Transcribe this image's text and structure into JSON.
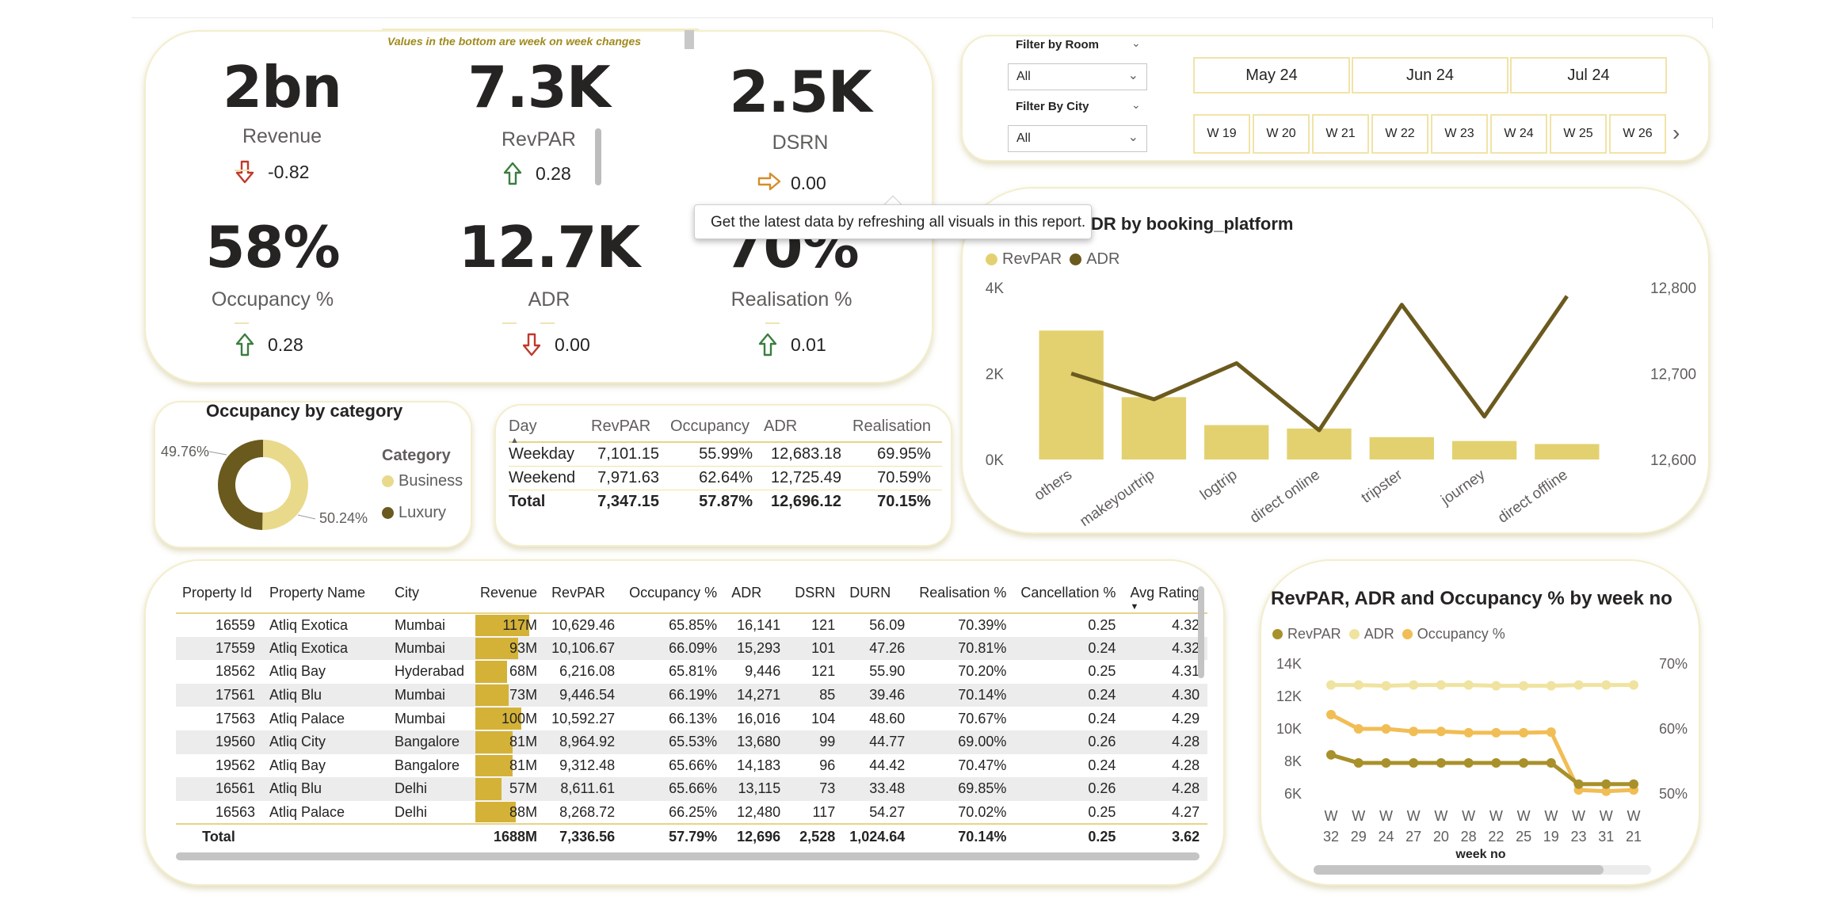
{
  "top_note": "Values in the bottom are week on week changes",
  "kpis": [
    {
      "value": "2bn",
      "label": "Revenue",
      "change": "-0.82",
      "direction": "down"
    },
    {
      "value": "7.3K",
      "label": "RevPAR",
      "change": "0.28",
      "direction": "up"
    },
    {
      "value": "2.5K",
      "label": "DSRN",
      "change": "0.00",
      "direction": "right"
    },
    {
      "value": "58%",
      "label": "Occupancy %",
      "change": "0.28",
      "direction": "up"
    },
    {
      "value": "12.7K",
      "label": "ADR",
      "change": "0.00",
      "direction": "down"
    },
    {
      "value": "70%",
      "label": "Realisation %",
      "change": "0.01",
      "direction": "up"
    }
  ],
  "tooltip": "Get the latest data by refreshing all visuals in this report.",
  "filters": {
    "room_title": "Filter by Room",
    "room_value": "All",
    "city_title": "Filter By City",
    "city_value": "All"
  },
  "months": [
    "May 24",
    "Jun 24",
    "Jul 24"
  ],
  "weeks": [
    "W 19",
    "W 20",
    "W 21",
    "W 22",
    "W 23",
    "W 24",
    "W 25",
    "W 26"
  ],
  "combo_chart": {
    "title": "DR by booking_platform",
    "legend": [
      "RevPAR",
      "ADR"
    ],
    "colors": {
      "revpar": "#e3d170",
      "adr": "#6b5a1e"
    }
  },
  "donut": {
    "title": "Occupancy by category",
    "legend_title": "Category",
    "colors": {
      "business": "#e9d98b",
      "luxury": "#6b5a1e"
    }
  },
  "day_table": {
    "headers": [
      "Day",
      "RevPAR",
      "Occupancy",
      "ADR",
      "Realisation"
    ],
    "rows": [
      [
        "Weekday",
        "7,101.15",
        "55.99%",
        "12,683.18",
        "69.95%"
      ],
      [
        "Weekend",
        "7,971.63",
        "62.64%",
        "12,725.49",
        "70.59%"
      ]
    ],
    "total": [
      "Total",
      "7,347.15",
      "57.87%",
      "12,696.12",
      "70.15%"
    ]
  },
  "property_table": {
    "headers": [
      "Property Id",
      "Property Name",
      "City",
      "Revenue",
      "RevPAR",
      "Occupancy %",
      "ADR",
      "DSRN",
      "DURN",
      "Realisation %",
      "Cancellation %",
      "Avg Rating"
    ],
    "rows": [
      [
        "16559",
        "Atliq Exotica",
        "Mumbai",
        "117M",
        "10,629.46",
        "65.85%",
        "16,141",
        "121",
        "56.09",
        "70.39%",
        "0.25",
        "4.32"
      ],
      [
        "17559",
        "Atliq Exotica",
        "Mumbai",
        "93M",
        "10,106.67",
        "66.09%",
        "15,293",
        "101",
        "47.26",
        "70.81%",
        "0.24",
        "4.32"
      ],
      [
        "18562",
        "Atliq Bay",
        "Hyderabad",
        "68M",
        "6,216.08",
        "65.81%",
        "9,446",
        "121",
        "55.90",
        "70.20%",
        "0.25",
        "4.31"
      ],
      [
        "17561",
        "Atliq Blu",
        "Mumbai",
        "73M",
        "9,446.54",
        "66.19%",
        "14,271",
        "85",
        "39.46",
        "70.14%",
        "0.24",
        "4.30"
      ],
      [
        "17563",
        "Atliq Palace",
        "Mumbai",
        "100M",
        "10,592.27",
        "66.13%",
        "16,016",
        "104",
        "48.60",
        "70.67%",
        "0.24",
        "4.29"
      ],
      [
        "19560",
        "Atliq City",
        "Bangalore",
        "81M",
        "8,964.92",
        "65.53%",
        "13,680",
        "99",
        "44.77",
        "69.00%",
        "0.26",
        "4.28"
      ],
      [
        "19562",
        "Atliq Bay",
        "Bangalore",
        "81M",
        "9,312.48",
        "65.66%",
        "14,183",
        "96",
        "44.42",
        "70.47%",
        "0.24",
        "4.28"
      ],
      [
        "16561",
        "Atliq Blu",
        "Delhi",
        "57M",
        "8,611.61",
        "65.66%",
        "13,115",
        "73",
        "33.48",
        "69.85%",
        "0.26",
        "4.28"
      ],
      [
        "16563",
        "Atliq Palace",
        "Delhi",
        "88M",
        "8,268.72",
        "66.25%",
        "12,480",
        "117",
        "54.27",
        "70.02%",
        "0.25",
        "4.27"
      ]
    ],
    "revenue_fraction": [
      1.0,
      0.795,
      0.581,
      0.624,
      0.855,
      0.692,
      0.692,
      0.487,
      0.752
    ],
    "total": [
      "Total",
      "",
      "",
      "1688M",
      "7,336.56",
      "57.79%",
      "12,696",
      "2,528",
      "1,024.64",
      "70.14%",
      "0.25",
      "3.62"
    ]
  },
  "week_chart": {
    "title": "RevPAR, ADR and Occupancy % by week no",
    "legend": [
      "RevPAR",
      "ADR",
      "Occupancy %"
    ],
    "colors": {
      "revpar": "#a8902a",
      "adr": "#f0e3a0",
      "occupancy": "#f1bd55"
    }
  },
  "chart_data": [
    {
      "type": "bar",
      "title": "DR by booking_platform",
      "categories": [
        "others",
        "makeyourtrip",
        "logtrip",
        "direct online",
        "tripster",
        "journey",
        "direct offline"
      ],
      "series": [
        {
          "name": "RevPAR",
          "type": "bar",
          "axis": "left",
          "values": [
            3000,
            1450,
            800,
            720,
            520,
            430,
            360
          ]
        },
        {
          "name": "ADR",
          "type": "line",
          "axis": "right",
          "values": [
            12700,
            12670,
            12712,
            12634,
            12780,
            12650,
            12790
          ]
        }
      ],
      "y_left": {
        "ticks": [
          "0K",
          "2K",
          "4K"
        ],
        "range": [
          0,
          4000
        ]
      },
      "y_right": {
        "ticks": [
          "12,600",
          "12,700",
          "12,800"
        ],
        "range": [
          12600,
          12800
        ]
      },
      "grid": false,
      "legend_position": "top-left"
    },
    {
      "type": "pie",
      "title": "Occupancy by category",
      "donut": true,
      "slices": [
        {
          "name": "Business",
          "value": 50.24,
          "label": "50.24%"
        },
        {
          "name": "Luxury",
          "value": 49.76,
          "label": "49.76%"
        }
      ],
      "legend_title": "Category",
      "legend_position": "right"
    },
    {
      "type": "line",
      "title": "RevPAR, ADR and Occupancy % by week no",
      "xlabel": "week no",
      "categories": [
        "W 32",
        "W 29",
        "W 24",
        "W 27",
        "W 20",
        "W 28",
        "W 22",
        "W 25",
        "W 19",
        "W 23",
        "W 31",
        "W 21"
      ],
      "series": [
        {
          "name": "RevPAR",
          "axis": "left",
          "values": [
            8400,
            7900,
            7900,
            7900,
            7900,
            7900,
            7900,
            7900,
            7900,
            6600,
            6600,
            6600
          ]
        },
        {
          "name": "ADR",
          "axis": "left",
          "values": [
            12700,
            12700,
            12650,
            12700,
            12700,
            12700,
            12650,
            12650,
            12650,
            12700,
            12700,
            12700
          ]
        },
        {
          "name": "Occupancy %",
          "axis": "right",
          "values": [
            62.2,
            60.0,
            60.0,
            59.6,
            59.6,
            59.4,
            59.4,
            59.4,
            59.5,
            50.6,
            50.4,
            50.6
          ]
        }
      ],
      "y_left": {
        "ticks": [
          "6K",
          "8K",
          "10K",
          "12K",
          "14K"
        ],
        "range": [
          6000,
          14000
        ]
      },
      "y_right": {
        "ticks": [
          "50%",
          "60%",
          "70%"
        ],
        "range": [
          50,
          70
        ]
      },
      "legend_position": "top-left"
    }
  ]
}
